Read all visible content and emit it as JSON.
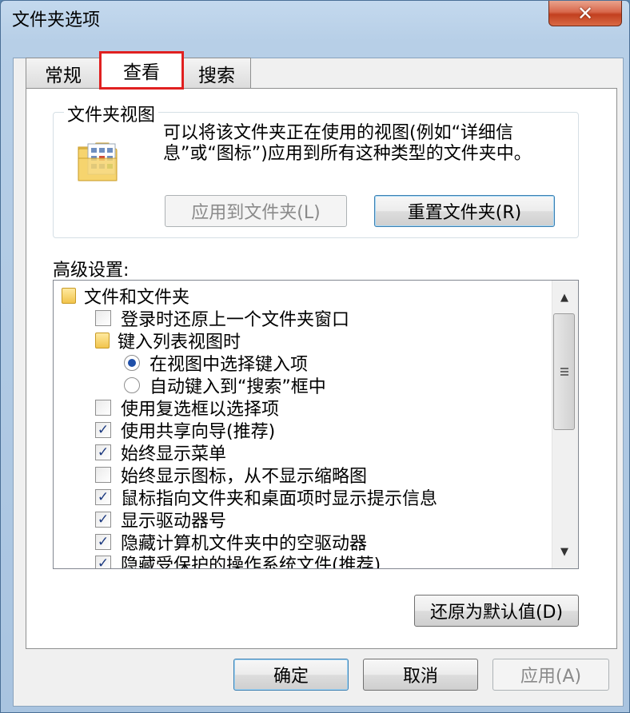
{
  "window": {
    "title": "文件夹选项",
    "close_glyph": "✕"
  },
  "tabs": [
    {
      "label": "常规"
    },
    {
      "label": "查看"
    },
    {
      "label": "搜索"
    }
  ],
  "folder_views": {
    "group_title": "文件夹视图",
    "description": "可以将该文件夹正在使用的视图(例如“详细信息”或“图标”)应用到所有这种类型的文件夹中。",
    "apply_button": "应用到文件夹(L)",
    "reset_button": "重置文件夹(R)"
  },
  "advanced": {
    "label": "高级设置:",
    "items": [
      {
        "type": "folder",
        "label": "文件和文件夹"
      },
      {
        "type": "checkbox",
        "checked": false,
        "label": "登录时还原上一个文件夹窗口"
      },
      {
        "type": "folder",
        "label": "键入列表视图时"
      },
      {
        "type": "radio",
        "checked": true,
        "label": "在视图中选择键入项"
      },
      {
        "type": "radio",
        "checked": false,
        "label": "自动键入到“搜索”框中"
      },
      {
        "type": "checkbox",
        "checked": false,
        "label": "使用复选框以选择项"
      },
      {
        "type": "checkbox",
        "checked": true,
        "label": "使用共享向导(推荐)"
      },
      {
        "type": "checkbox",
        "checked": true,
        "label": "始终显示菜单"
      },
      {
        "type": "checkbox",
        "checked": false,
        "label": "始终显示图标，从不显示缩略图"
      },
      {
        "type": "checkbox",
        "checked": true,
        "label": "鼠标指向文件夹和桌面项时显示提示信息"
      },
      {
        "type": "checkbox",
        "checked": true,
        "label": "显示驱动器号"
      },
      {
        "type": "checkbox",
        "checked": true,
        "label": "隐藏计算机文件夹中的空驱动器"
      },
      {
        "type": "checkbox",
        "checked": true,
        "label": "隐藏受保护的操作系统文件(推荐)"
      }
    ],
    "restore_defaults": "还原为默认值(D)"
  },
  "footer": {
    "ok": "确定",
    "cancel": "取消",
    "apply": "应用(A)"
  },
  "colors": {
    "highlight_border": "#e02020",
    "check_color": "#1c3a80"
  }
}
